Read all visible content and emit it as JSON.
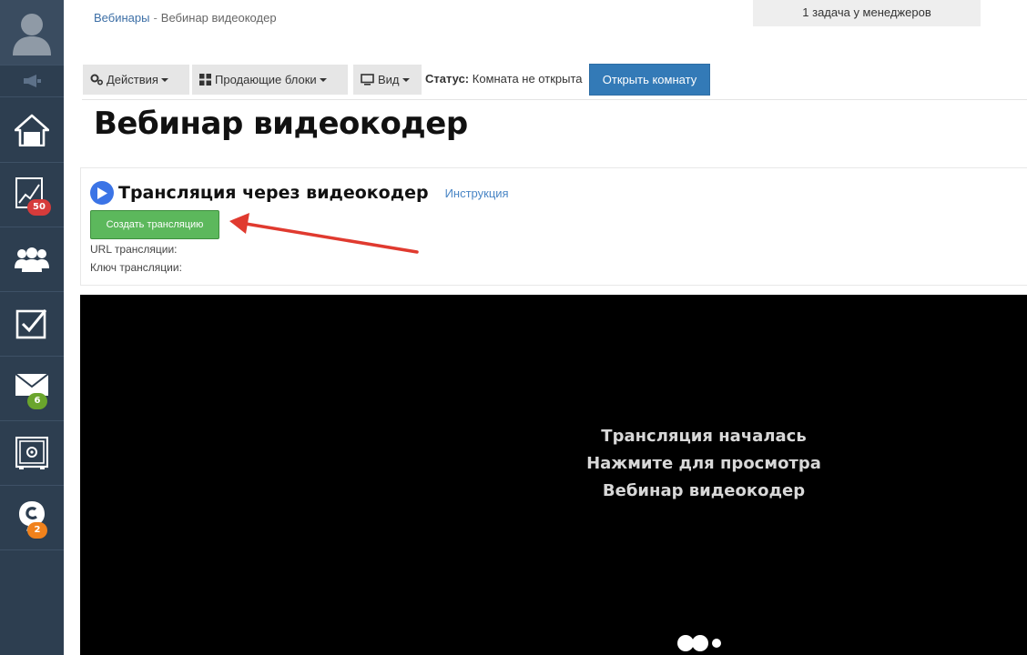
{
  "breadcrumb": {
    "parent": "Вебинары",
    "separator": "-",
    "current": "Вебинар видеокодер"
  },
  "tasks_notice": "1 задача у менеджеров",
  "toolbar": {
    "actions_label": "Действия",
    "blocks_label": "Продающие блоки",
    "view_label": "Вид",
    "status_label": "Статус:",
    "status_value": "Комната не открыта",
    "open_room_label": "Открыть комнату"
  },
  "page_title": "Вебинар видеокодер",
  "stream": {
    "title": "Трансляция через видеокодер",
    "instruction_link": "Инструкция",
    "create_button": "Создать трансляцию",
    "url_label": "URL трансляции:",
    "key_label": "Ключ трансляции:"
  },
  "video": {
    "line1": "Трансляция началась",
    "line2": "Нажмите для просмотра",
    "line3": "Вебинар видеокодер"
  },
  "sidebar": {
    "items": [
      {
        "name": "avatar"
      },
      {
        "name": "announcements-icon"
      },
      {
        "name": "home-icon"
      },
      {
        "name": "stats-icon",
        "badge": "50"
      },
      {
        "name": "users-icon"
      },
      {
        "name": "tasks-icon"
      },
      {
        "name": "mail-icon",
        "badge": "6"
      },
      {
        "name": "safe-icon"
      },
      {
        "name": "chat-icon",
        "badge": "2"
      }
    ]
  },
  "colors": {
    "sidebar_bg": "#2d3e50",
    "primary_button": "#337ab7",
    "success_button": "#5cb85c",
    "arrow": "#e03a2f",
    "play_icon": "#3b74e6"
  }
}
